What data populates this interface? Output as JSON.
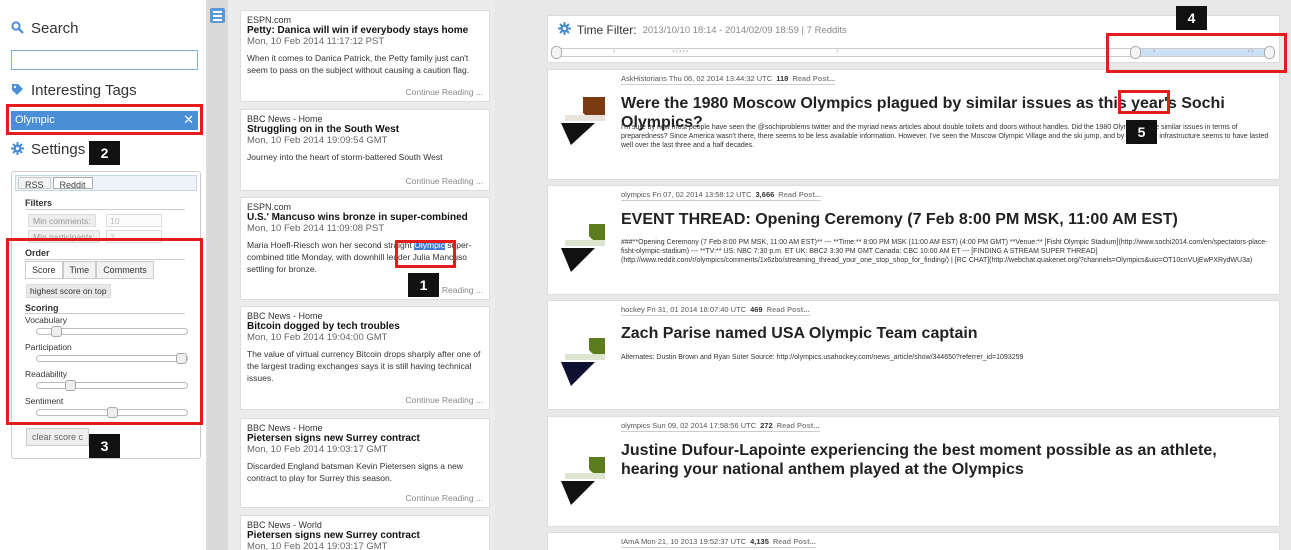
{
  "sidebar": {
    "search_label": "Search",
    "search_value": "",
    "tags_label": "Interesting Tags",
    "active_tag": "Olympic",
    "tag_remove": "✕",
    "settings_label": "Settings",
    "tabs": [
      "RSS",
      "Reddit"
    ],
    "filters_label": "Filters",
    "min_comments_label": "Min comments:",
    "min_comments_value": "10",
    "min_participants_label": "Min participants:",
    "min_participants_value": "2",
    "order_label": "Order",
    "order_buttons": [
      "Score",
      "Time",
      "Comments"
    ],
    "order_pill": "highest score on top",
    "scoring_label": "Scoring",
    "scoring": [
      {
        "label": "Vocabulary",
        "level": 0.1
      },
      {
        "label": "Participation",
        "level": 1.0
      },
      {
        "label": "Readability",
        "level": 0.2
      },
      {
        "label": "Sentiment",
        "level": 0.5
      }
    ],
    "clear_button": "clear score c"
  },
  "news": [
    {
      "source": "ESPN.com",
      "title": "Petty: Danica will win if everybody stays home",
      "date": "Mon, 10 Feb 2014 11:17:12 PST",
      "body": "When it comes to Danica Patrick, the Petty family just can't seem to pass on the subject without causing a caution flag.",
      "more": "Continue Reading ..."
    },
    {
      "source": "BBC News - Home",
      "title": "Struggling on in the South West",
      "date": "Mon, 10 Feb 2014 19:09:54 GMT",
      "body": "Journey into the heart of storm-battered South West",
      "more": "Continue Reading ..."
    },
    {
      "source": "ESPN.com",
      "title": "U.S.' Mancuso wins bronze in super-combined",
      "date": "Mon, 10 Feb 2014 11:09:08 PST",
      "body_pre": "Maria Hoefl-Riesch won her second straight ",
      "body_hl": "Olympic",
      "body_post": " super-combined title Monday, with downhill leader Julia Mancuso settling for bronze.",
      "more": "Reading ..."
    },
    {
      "source": "BBC News - Home",
      "title": "Bitcoin dogged by tech troubles",
      "date": "Mon, 10 Feb 2014 19:04:00 GMT",
      "body": "The value of virtual currency Bitcoin drops sharply after one of the largest trading exchanges says it is still having technical issues.",
      "more": "Continue Reading ..."
    },
    {
      "source": "BBC News - Home",
      "title": "Pietersen signs new Surrey contract",
      "date": "Mon, 10 Feb 2014 19:03:17 GMT",
      "body": "Discarded England batsman Kevin Pietersen signs a new contract to play for Surrey this season.",
      "more": "Continue Reading ..."
    },
    {
      "source": "BBC News - World",
      "title": "Pietersen signs new Surrey contract",
      "date": "Mon, 10 Feb 2014 19:03:17 GMT"
    }
  ],
  "time_filter": {
    "label": "Time Filter:",
    "range": "2013/10/10 18:14 - 2014/02/09 18:59 | 7 Reddits",
    "range_start": 0.8,
    "range_end": 1.0
  },
  "posts": [
    {
      "sub": "AskHistorians",
      "date": "Thu 06, 02 2014 13:44:32 UTC",
      "score": "118",
      "read": "Read Post...",
      "title_pre": "Were the 1980 Moscow Olympics plagued by similar issues as this year's ",
      "title_hl": "Sochi",
      "title_post": " Olympics?",
      "body": "I'm sure by now most people have seen the @sochiproblems twitter and the myriad news articles about double toilets and doors without handles. Did the 1980 Olympics have similar issues in terms of preparedness? Since America wasn't there, there seems to be less available information. However, I've seen the Moscow Olympic Village and the ski jump, and by now -- the infrastructure seems to have lasted well over the last three and a half decades.",
      "logo_top": "#7a3b12",
      "logo_bottom": "#111111"
    },
    {
      "sub": "olympics",
      "date": "Fri 07, 02 2014 13:58:12 UTC",
      "score": "3,666",
      "read": "Read Post...",
      "title": "EVENT THREAD: Opening Ceremony (7 Feb 8:00 PM MSK, 11:00 AM EST)",
      "body": "###**Opening Ceremony (7 Feb 8:00 PM MSK, 11:00 AM EST)** --- **Time:** 8:00 PM MSK (11:00 AM EST) (4:00 PM GMT) **Venue:** [Fisht Olympic Stadium](http://www.sochi2014.com/en/spectators-place-fisht-olympic-stadium) --- **TV:** US: NBC 7:30 p.m. ET UK: BBC2 3:30 PM GMT Canada: CBC 10:00 AM ET --- [FINDING A STREAM SUPER THREAD](http://www.reddit.com/r/olympics/comments/1x6zbo/streaming_thread_your_one_stop_shop_for_finding/) | [RC CHAT](http://webchat.quakenet.org/?channels=Olympics&uio=OT10cnVUjEwPXRydWU3a)",
      "logo_top": "#5b7d1e",
      "logo_bottom": "#111111"
    },
    {
      "sub": "hockey",
      "date": "Fri 31, 01 2014 18:07:40 UTC",
      "score": "469",
      "read": "Read Post...",
      "title": "Zach Parise named USA Olympic Team captain",
      "body": "Alternates: Dustin Brown and Ryan Suter Source: http://olympics.usahockey.com/news_article/show/344650?referrer_id=1093259",
      "logo_top": "#5b7d1e",
      "logo_bottom": "#0e1030"
    },
    {
      "sub": "olympics",
      "date": "Sun 09, 02 2014 17:58:56 UTC",
      "score": "272",
      "read": "Read Post...",
      "title": "Justine Dufour-Lapointe experiencing the best moment possible as an athlete, hearing your national anthem played at the Olympics",
      "body": "",
      "logo_top": "#5b7d1e",
      "logo_bottom": "#111111"
    },
    {
      "sub": "IAmA",
      "date": "Mon 21, 10 2013 19:52:37 UTC",
      "score": "4,135",
      "read": "Read Post..."
    }
  ],
  "annotations": [
    "1",
    "2",
    "3",
    "4",
    "5"
  ],
  "colors": {
    "accent": "#4a8fd6",
    "annotation": "#e31c1c"
  }
}
